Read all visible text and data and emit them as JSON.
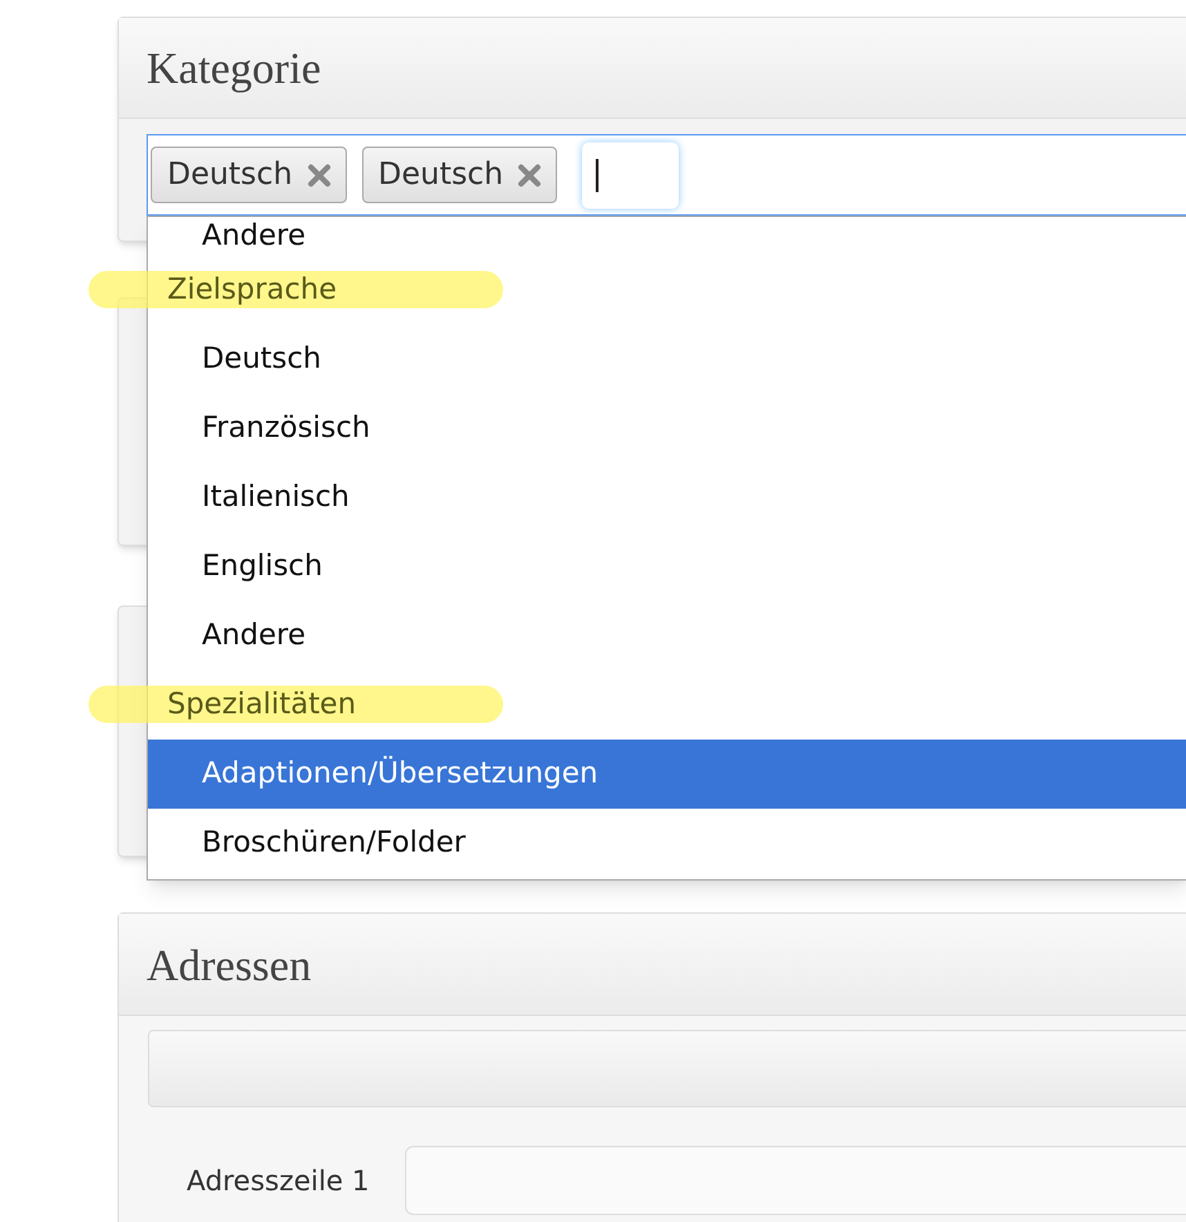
{
  "category_panel": {
    "title": "Kategorie",
    "tags": [
      {
        "label": "Deutsch"
      },
      {
        "label": "Deutsch"
      }
    ]
  },
  "dropdown": {
    "items": [
      {
        "kind": "option",
        "label": "Andere",
        "selected": false
      },
      {
        "kind": "group",
        "label": "Zielsprache",
        "highlighted": true
      },
      {
        "kind": "option",
        "label": "Deutsch",
        "selected": false
      },
      {
        "kind": "option",
        "label": "Französisch",
        "selected": false
      },
      {
        "kind": "option",
        "label": "Italienisch",
        "selected": false
      },
      {
        "kind": "option",
        "label": "Englisch",
        "selected": false
      },
      {
        "kind": "option",
        "label": "Andere",
        "selected": false
      },
      {
        "kind": "group",
        "label": "Spezialitäten",
        "highlighted": true
      },
      {
        "kind": "option",
        "label": "Adaptionen/Übersetzungen",
        "selected": true
      },
      {
        "kind": "option",
        "label": "Broschüren/Folder",
        "selected": false
      }
    ]
  },
  "address_panel": {
    "title": "Adressen",
    "fields": [
      {
        "label": "Adresszeile 1"
      }
    ]
  }
}
